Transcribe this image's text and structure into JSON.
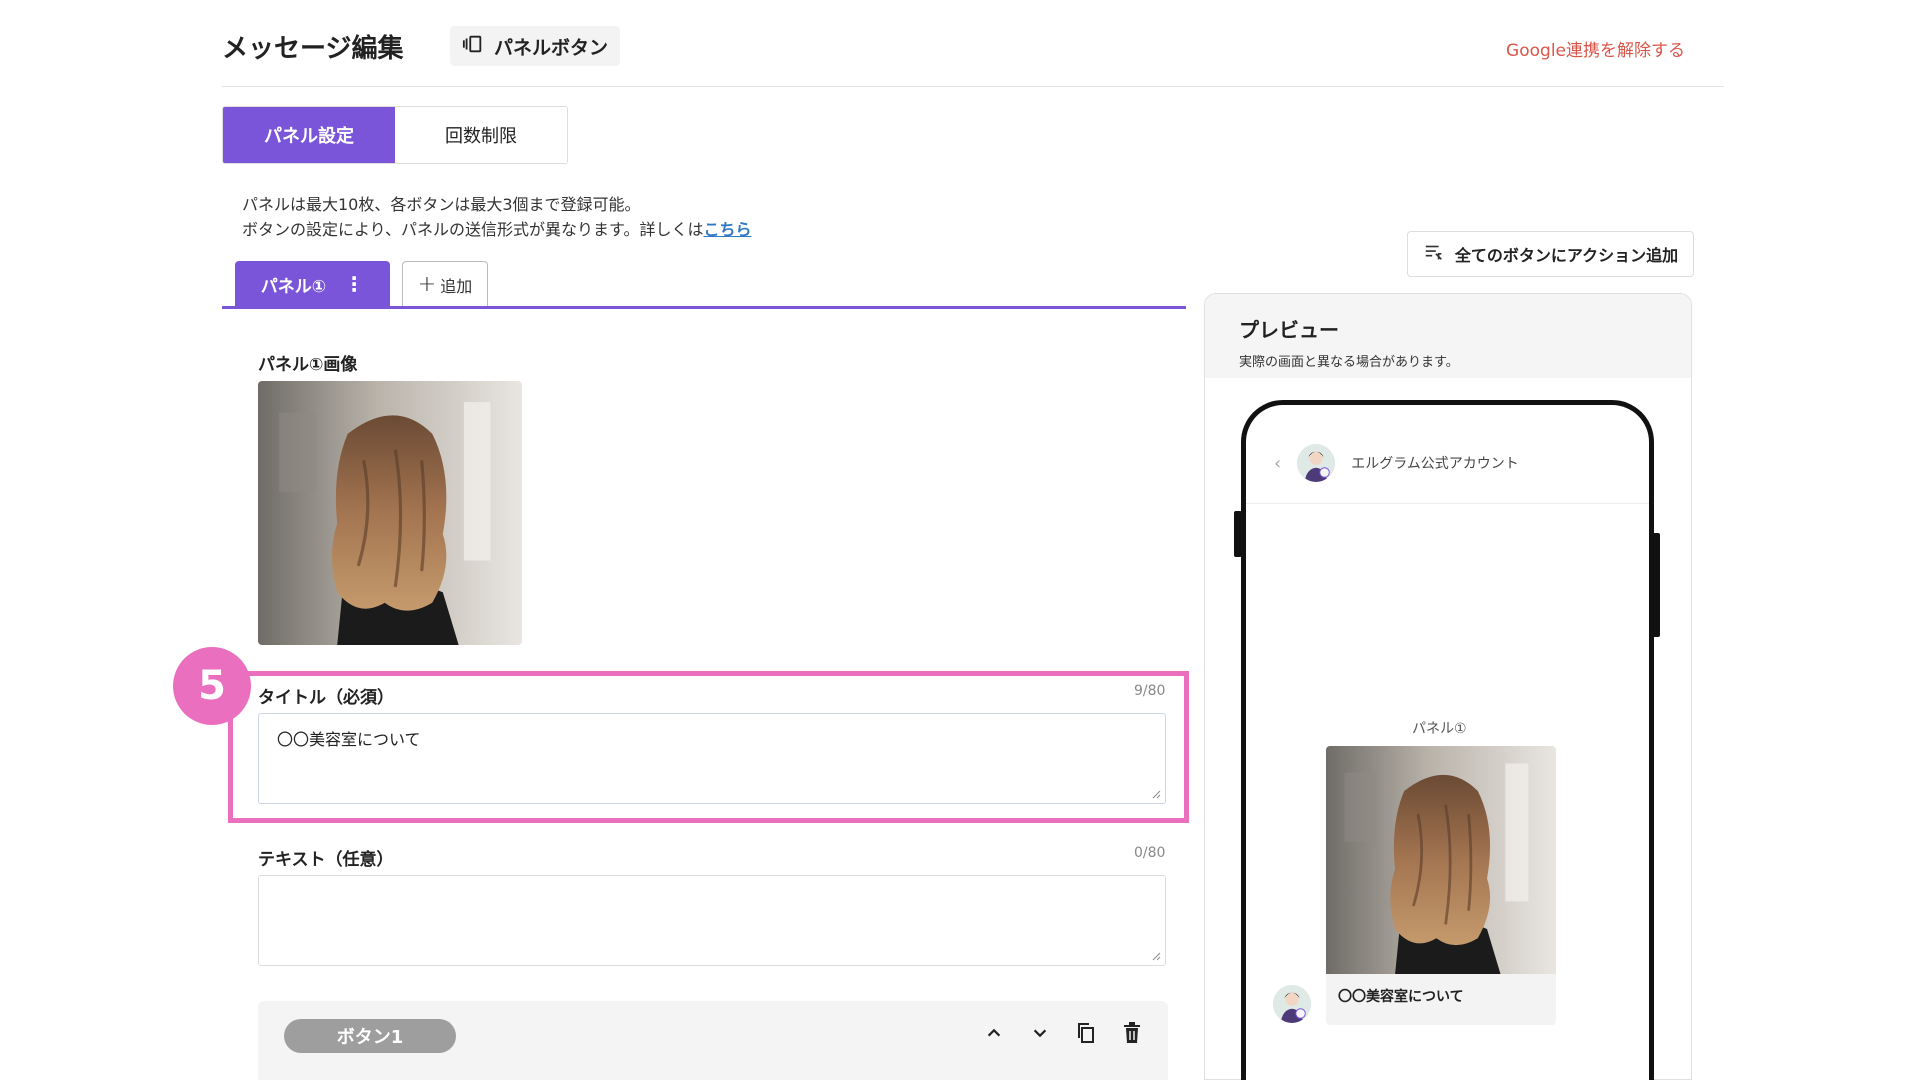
{
  "header": {
    "title": "メッセージ編集",
    "type_badge": "パネルボタン",
    "google_link": "Google連携を解除する"
  },
  "mode_tabs": [
    {
      "label": "パネル設定",
      "active": true
    },
    {
      "label": "回数制限",
      "active": false
    }
  ],
  "note": {
    "line1": "パネルは最大10枚、各ボタンは最大3個まで登録可能。",
    "line2": "ボタンの設定により、パネルの送信形式が異なります。詳しくは",
    "link": "こちら"
  },
  "panel_tabs": {
    "active_label": "パネル①",
    "add_label": "追加"
  },
  "image_field": {
    "label": "パネル①画像"
  },
  "title_field": {
    "label": "タイトル（必須）",
    "counter": "9/80",
    "value": "〇〇美容室について"
  },
  "text_field": {
    "label": "テキスト（任意）",
    "counter": "0/80",
    "value": ""
  },
  "button_row": {
    "label": "ボタン1"
  },
  "step_badge": "5",
  "action_button": "全てのボタンにアクション追加",
  "preview": {
    "title": "プレビュー",
    "subtitle": "実際の画面と異なる場合があります。",
    "account_name": "エルグラム公式アカウント",
    "panel_label": "パネル①",
    "card_title": "〇〇美容室について"
  },
  "colors": {
    "accent": "#7a55d9",
    "highlight": "#ea6fbf",
    "link": "#2f78c4",
    "danger_link": "#d9564a"
  }
}
